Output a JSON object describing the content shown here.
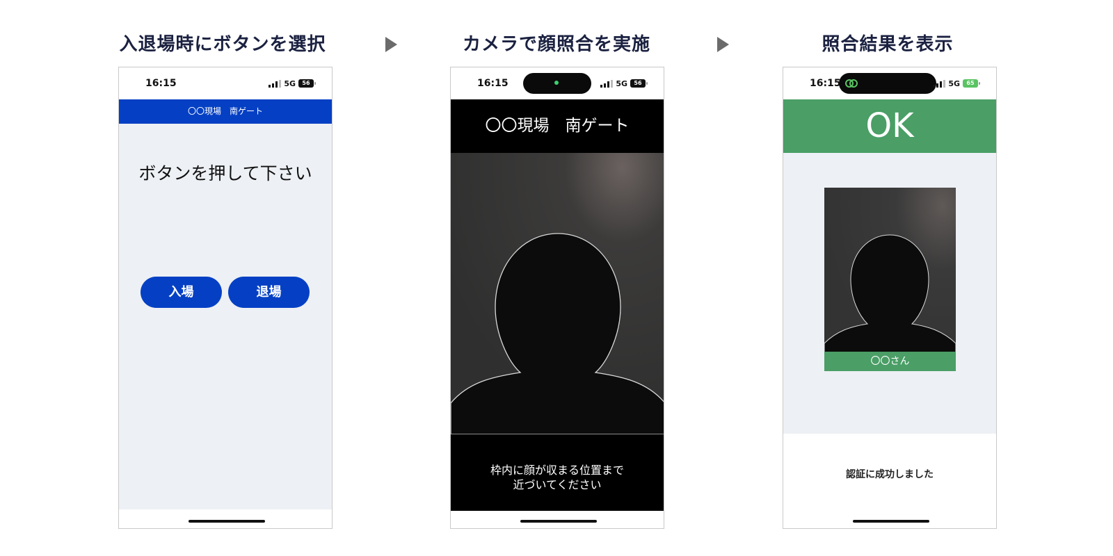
{
  "steps": [
    {
      "title": "入退場時にボタンを選択"
    },
    {
      "title": "カメラで顔照合を実施"
    },
    {
      "title": "照合結果を表示"
    }
  ],
  "status_bar": {
    "time": "16:15",
    "network": "5G",
    "battery_1": "56",
    "battery_2": "56",
    "battery_3": "65"
  },
  "screen1": {
    "header": "〇〇現場　南ゲート",
    "prompt": "ボタンを押して下さい",
    "enter_button": "入場",
    "exit_button": "退場"
  },
  "screen2": {
    "header": "〇〇現場　南ゲート",
    "instruction_line1": "枠内に顔が収まる位置まで",
    "instruction_line2": "近づいてください"
  },
  "screen3": {
    "result": "OK",
    "name_label": "〇〇さん",
    "message": "認証に成功しました"
  },
  "colors": {
    "primary_blue": "#0540c4",
    "success_green": "#4a9e66",
    "panel_bg": "#edf0f4"
  }
}
